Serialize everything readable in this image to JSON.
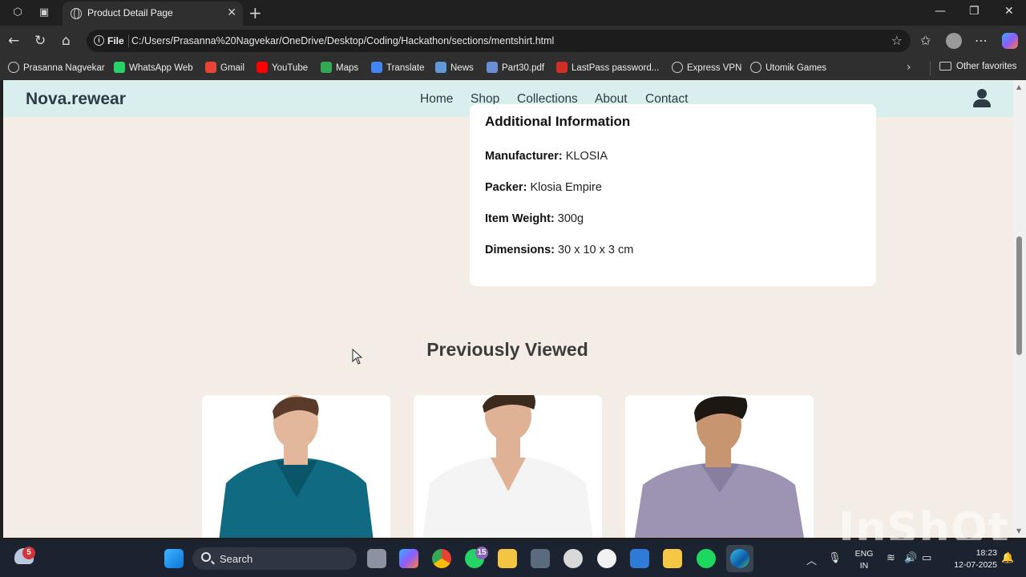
{
  "browser": {
    "tab_title": "Product Detail Page",
    "tab_close": "✕",
    "new_tab": "+",
    "url_scheme_label": "File",
    "url": "C:/Users/Prasanna%20Nagvekar/OneDrive/Desktop/Coding/Hackathon/sections/mentshirt.html",
    "favorites": [
      {
        "label": "Prasanna Nagvekar",
        "icon": "globe-icon",
        "color": "#cfcfcf"
      },
      {
        "label": "WhatsApp Web",
        "icon": "whatsapp-icon",
        "color": "#25d366"
      },
      {
        "label": "Gmail",
        "icon": "gmail-icon",
        "color": "#ea4335"
      },
      {
        "label": "YouTube",
        "icon": "youtube-icon",
        "color": "#ff0000"
      },
      {
        "label": "Maps",
        "icon": "maps-icon",
        "color": "#34a853"
      },
      {
        "label": "Translate",
        "icon": "translate-icon",
        "color": "#4285f4"
      },
      {
        "label": "News",
        "icon": "news-icon",
        "color": "#5f9ad7"
      },
      {
        "label": "Part30.pdf",
        "icon": "pdf-icon",
        "color": "#6b8fd6"
      },
      {
        "label": "LastPass password...",
        "icon": "lastpass-icon",
        "color": "#d32d27"
      },
      {
        "label": "Express VPN",
        "icon": "globe-icon",
        "color": "#cfcfcf"
      },
      {
        "label": "Utomik Games",
        "icon": "globe-icon",
        "color": "#cfcfcf"
      }
    ],
    "other_favorites": "Other favorites"
  },
  "site": {
    "logo": "Nova.rewear",
    "nav": [
      "Home",
      "Shop",
      "Collections",
      "About",
      "Contact"
    ]
  },
  "additional_info": {
    "title": "Additional Information",
    "rows": [
      {
        "label": "Manufacturer:",
        "value": "KLOSIA"
      },
      {
        "label": "Packer:",
        "value": "Klosia Empire"
      },
      {
        "label": "Item Weight:",
        "value": "300g"
      },
      {
        "label": "Dimensions:",
        "value": "30 x 10 x 3 cm"
      }
    ]
  },
  "previously_viewed": {
    "title": "Previously Viewed",
    "products": [
      {
        "shirt_color": "#0f6a82",
        "skin": "#e2b79c",
        "hair": "#5a3a28"
      },
      {
        "shirt_color": "#f4f4f4",
        "skin": "#e0b295",
        "hair": "#3d2a1e"
      },
      {
        "shirt_color": "#9d94b4",
        "skin": "#c7956f",
        "hair": "#1d1712"
      }
    ]
  },
  "watermark": "InShOt",
  "taskbar": {
    "search_label": "Search",
    "weather_badge": "5",
    "whatsapp_badge": "15",
    "lang_line1": "ENG",
    "lang_line2": "IN",
    "time": "18:23",
    "date": "12-07-2025"
  }
}
